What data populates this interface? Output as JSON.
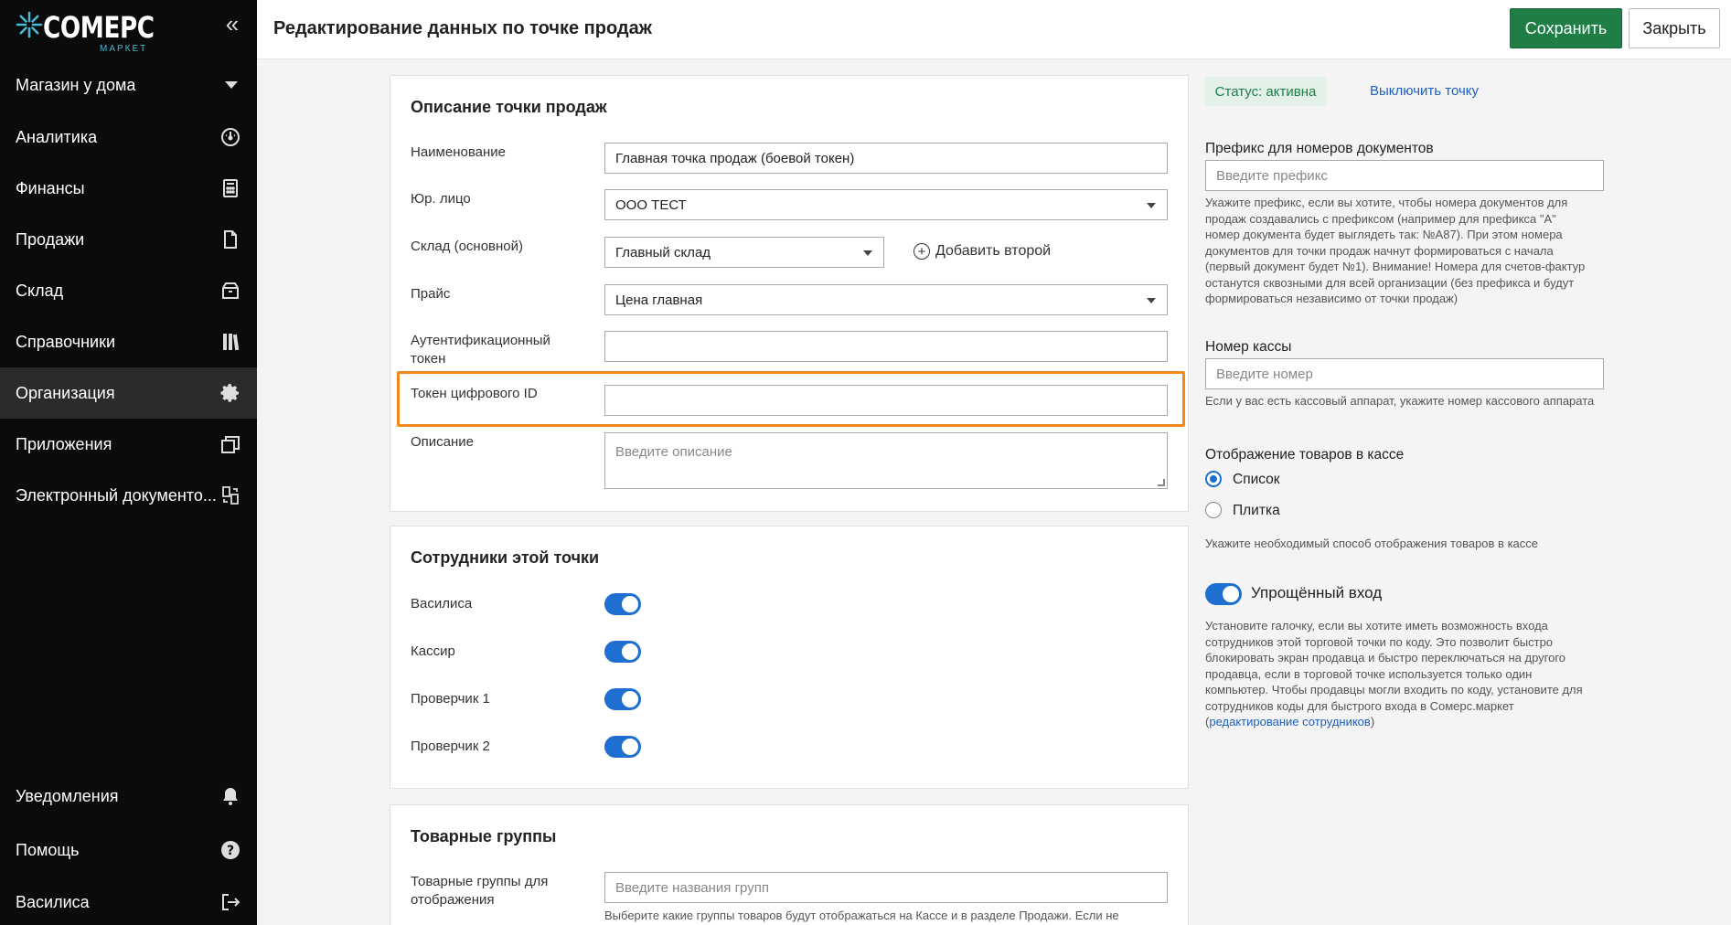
{
  "app": {
    "logo_text": "COMEPC",
    "logo_sub": "МАРКЕТ"
  },
  "header": {
    "title": "Редактирование данных по точке продаж",
    "save_label": "Сохранить",
    "close_label": "Закрыть"
  },
  "sidebar": {
    "store": "Магазин у дома",
    "items": [
      {
        "label": "Аналитика",
        "icon": "dashboard-icon"
      },
      {
        "label": "Финансы",
        "icon": "calculator-icon"
      },
      {
        "label": "Продажи",
        "icon": "document-icon"
      },
      {
        "label": "Склад",
        "icon": "box-icon"
      },
      {
        "label": "Справочники",
        "icon": "books-icon"
      },
      {
        "label": "Организация",
        "icon": "gear-icon"
      },
      {
        "label": "Приложения",
        "icon": "windows-icon"
      },
      {
        "label": "Электронный документо...",
        "icon": "document-transfer-icon"
      }
    ],
    "bottom": [
      {
        "label": "Уведомления",
        "icon": "bell-icon"
      },
      {
        "label": "Помощь",
        "icon": "help-icon"
      },
      {
        "label": "Василиса",
        "icon": "logout-icon"
      }
    ]
  },
  "description": {
    "title": "Описание точки продаж",
    "name_label": "Наименование",
    "name_value": "Главная точка продаж (боевой токен)",
    "legal_label": "Юр. лицо",
    "legal_value": "ООО ТЕСТ",
    "warehouse_label": "Склад (основной)",
    "warehouse_value": "Главный склад",
    "add_second": "Добавить второй",
    "price_label": "Прайс",
    "price_value": "Цена главная",
    "auth_label_1": "Аутентификационный",
    "auth_label_2": "токен",
    "auth_value": "",
    "digital_id_label": "Токен цифрового ID",
    "digital_id_value": "",
    "desc_label": "Описание",
    "desc_placeholder": "Введите описание"
  },
  "employees": {
    "title": "Сотрудники этой точки",
    "list": [
      {
        "name": "Василиса",
        "enabled": true
      },
      {
        "name": "Кассир",
        "enabled": true
      },
      {
        "name": "Проверчик 1",
        "enabled": true
      },
      {
        "name": "Проверчик 2",
        "enabled": true
      }
    ]
  },
  "groups": {
    "title": "Товарные группы",
    "label_1": "Товарные группы для",
    "label_2": "отображения",
    "placeholder": "Введите названия групп",
    "helper": "Выберите какие группы товаров будут отображаться на Кассе и в разделе Продажи. Если не"
  },
  "right": {
    "status": "Статус: активна",
    "disable_link": "Выключить точку",
    "prefix_label": "Префикс для номеров документов",
    "prefix_placeholder": "Введите префикс",
    "prefix_help": [
      "Укажите префикс, если вы хотите, чтобы номера документов для",
      "продаж создавались с префиксом (например для префикса \"А\"",
      "номер документа будет выглядеть так: №А87). При этом номера",
      "документов для точки продаж начнут формироваться с начала",
      "(первый документ будет №1). Внимание! Номера для счетов-фактур",
      "останутся сквозными для всей организации (без префикса и будут",
      "формироваться независимо от точки продаж)"
    ],
    "register_label": "Номер кассы",
    "register_placeholder": "Введите номер",
    "register_help": "Если у вас есть кассовый аппарат, укажите номер кассового аппарата",
    "display_label": "Отображение товаров в кассе",
    "display_options": [
      "Список",
      "Плитка"
    ],
    "display_selected": "Список",
    "display_help": "Укажите необходимый способ отображения товаров в кассе",
    "simple_login_label": "Упрощённый вход",
    "simple_login_enabled": true,
    "simple_login_help": [
      "Установите галочку, если вы хотите иметь возможность входа",
      "сотрудников этой торговой точки по коду. Это позволит быстро",
      "блокировать экран продавца и быстро переключаться на другого",
      "продавца, если в торговой точке используется только один",
      "компьютер. Чтобы продавцы могли входить по коду, установите для",
      "сотрудников коды для быстрого входа в Сомерс.маркет"
    ],
    "edit_employees_link": "редактирование сотрудников",
    "paren_open": "(",
    "paren_close": ")"
  }
}
